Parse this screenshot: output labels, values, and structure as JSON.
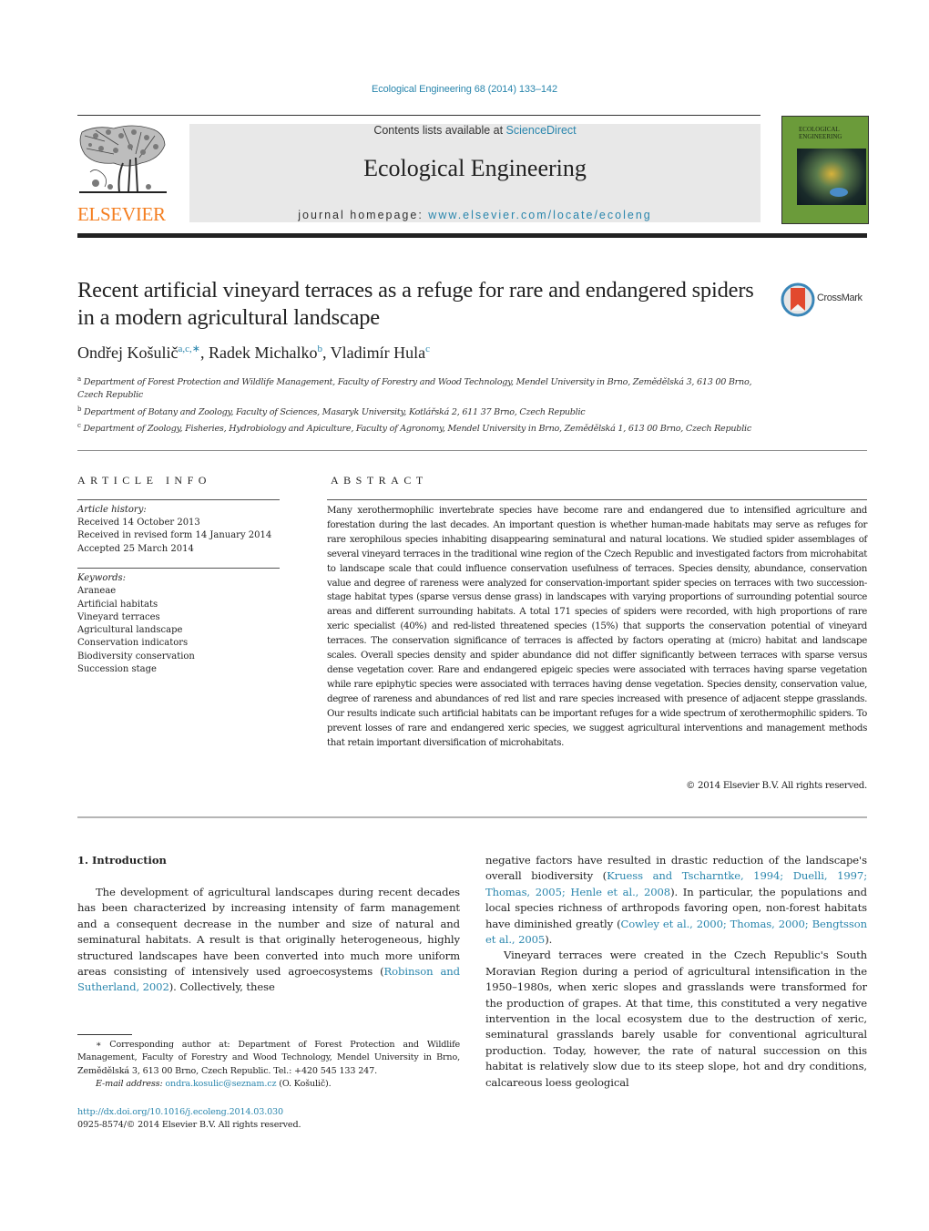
{
  "header": {
    "citation": "Ecological Engineering 68 (2014) 133–142",
    "contents_prefix": "Contents lists available at ",
    "contents_link": "ScienceDirect",
    "journal_name": "Ecological Engineering",
    "homepage_prefix": "journal homepage: ",
    "homepage_link": "www.elsevier.com/locate/ecoleng",
    "publisher_logo_text": "ELSEVIER",
    "cover_title_line1": "ECOLOGICAL",
    "cover_title_line2": "ENGINEERING",
    "brand_color": "#f47e20",
    "link_color": "#2a86ad"
  },
  "article": {
    "title": "Recent artificial vineyard terraces as a refuge for rare and endangered spiders in a modern agricultural landscape",
    "crossmark_label": "CrossMark",
    "authors": [
      {
        "name": "Ondřej Košulič",
        "sup": "a,c,∗"
      },
      {
        "name": "Radek Michalko",
        "sup": "b"
      },
      {
        "name": "Vladimír Hula",
        "sup": "c"
      }
    ],
    "affiliations": [
      {
        "sup": "a",
        "text": "Department of Forest Protection and Wildlife Management, Faculty of Forestry and Wood Technology, Mendel University in Brno, Zemědělská 3, 613 00 Brno, Czech Republic"
      },
      {
        "sup": "b",
        "text": "Department of Botany and Zoology, Faculty of Sciences, Masaryk University, Kotlářská 2, 611 37 Brno, Czech Republic"
      },
      {
        "sup": "c",
        "text": "Department of Zoology, Fisheries, Hydrobiology and Apiculture, Faculty of Agronomy, Mendel University in Brno, Zemědělská 1, 613 00 Brno, Czech Republic"
      }
    ]
  },
  "article_info": {
    "heading": "ARTICLE INFO",
    "history_label": "Article history:",
    "history": [
      "Received 14 October 2013",
      "Received in revised form 14 January 2014",
      "Accepted 25 March 2014"
    ],
    "keywords_label": "Keywords:",
    "keywords": [
      "Araneae",
      "Artificial habitats",
      "Vineyard terraces",
      "Agricultural landscape",
      "Conservation indicators",
      "Biodiversity conservation",
      "Succession stage"
    ]
  },
  "abstract": {
    "heading": "ABSTRACT",
    "text": "Many xerothermophilic invertebrate species have become rare and endangered due to intensified agriculture and forestation during the last decades. An important question is whether human-made habitats may serve as refuges for rare xerophilous species inhabiting disappearing seminatural and natural locations. We studied spider assemblages of several vineyard terraces in the traditional wine region of the Czech Republic and investigated factors from microhabitat to landscape scale that could influence conservation usefulness of terraces. Species density, abundance, conservation value and degree of rareness were analyzed for conservation-important spider species on terraces with two succession-stage habitat types (sparse versus dense grass) in landscapes with varying proportions of surrounding potential source areas and different surrounding habitats. A total 171 species of spiders were recorded, with high proportions of rare xeric specialist (40%) and red-listed threatened species (15%) that supports the conservation potential of vineyard terraces. The conservation significance of terraces is affected by factors operating at (micro) habitat and landscape scales. Overall species density and spider abundance did not differ significantly between terraces with sparse versus dense vegetation cover. Rare and endangered epigeic species were associated with terraces having sparse vegetation while rare epiphytic species were associated with terraces having dense vegetation. Species density, conservation value, degree of rareness and abundances of red list and rare species increased with presence of adjacent steppe grasslands. Our results indicate such artificial habitats can be important refuges for a wide spectrum of xerothermophilic spiders. To prevent losses of rare and endangered xeric species, we suggest agricultural interventions and management methods that retain important diversification of microhabitats.",
    "copyright": "© 2014 Elsevier B.V. All rights reserved."
  },
  "introduction": {
    "heading": "1.  Introduction",
    "left_p1_text": "The development of agricultural landscapes during recent decades has been characterized by increasing intensity of farm management and a consequent decrease in the number and size of natural and seminatural habitats. A result is that originally heterogeneous, highly structured landscapes have been converted into much more uniform areas consisting of intensively used agroecosystems (",
    "left_p1_ref": "Robinson and Sutherland, 2002",
    "left_p1_end": "). Collectively, these",
    "right_p1_a": "negative factors have resulted in drastic reduction of the landscape's overall biodiversity (",
    "right_p1_ref1": "Kruess and Tscharntke, 1994; Duelli, 1997; Thomas, 2005; Henle et al., 2008",
    "right_p1_b": "). In particular, the populations and local species richness of arthropods favoring open, non-forest habitats have diminished greatly (",
    "right_p1_ref2": "Cowley et al., 2000; Thomas, 2000; Bengtsson et al., 2005",
    "right_p1_c": ").",
    "right_p2": "Vineyard terraces were created in the Czech Republic's South Moravian Region during a period of agricultural intensification in the 1950–1980s, when xeric slopes and grasslands were transformed for the production of grapes. At that time, this constituted a very negative intervention in the local ecosystem due to the destruction of xeric, seminatural grasslands barely usable for conventional agricultural production. Today, however, the rate of natural succession on this habitat is relatively slow due to its steep slope, hot and dry conditions, calcareous loess geological"
  },
  "footnote": {
    "corresponding": "∗ Corresponding author at: Department of Forest Protection and Wildlife Management, Faculty of Forestry and Wood Technology, Mendel University in Brno, Zemědělská 3, 613 00 Brno, Czech Republic. Tel.: +420 545 133 247.",
    "email_label": "E-mail address: ",
    "email": "ondra.kosulic@seznam.cz",
    "email_owner": " (O. Košulič).",
    "doi": "http://dx.doi.org/10.1016/j.ecoleng.2014.03.030",
    "issn_line": "0925-8574/© 2014 Elsevier B.V. All rights reserved."
  }
}
